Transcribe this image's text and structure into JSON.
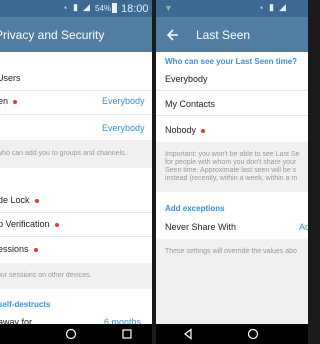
{
  "left": {
    "status": {
      "battery": "54%",
      "time": "18:00"
    },
    "title": "Privacy and Security",
    "rows": {
      "users": "Users",
      "last_seen": "en",
      "last_seen_value": "Everybody",
      "groups_value": "Everybody",
      "groups_note": "who can add you to groups and channels.",
      "passcode": "de Lock",
      "two_step": "p Verification",
      "sessions": "essions",
      "sessions_note": "our sessions on other devices.",
      "self_destruct_header": "self-destructs",
      "away_label": "away for",
      "away_value": "6 months"
    }
  },
  "right": {
    "title": "Last Seen",
    "header": "Who can see your Last Seen time?",
    "options": [
      "Everybody",
      "My Contacts",
      "Nobody"
    ],
    "info_lines": [
      "Important: you won't be able to see Last Se",
      "for people with whom you don't share your",
      "Seen time. Approximate last seen will be s",
      "instead (recently, within a week, within a m"
    ],
    "exceptions_header": "Add exceptions",
    "never_share": "Never Share With",
    "never_share_value": "Ad",
    "footer_note": "These settings will override the values abo"
  },
  "colors": {
    "appbar": "#527da3",
    "statusbar": "#3d6a93",
    "accent": "#3e8ed2",
    "red_dot": "#e53935"
  }
}
